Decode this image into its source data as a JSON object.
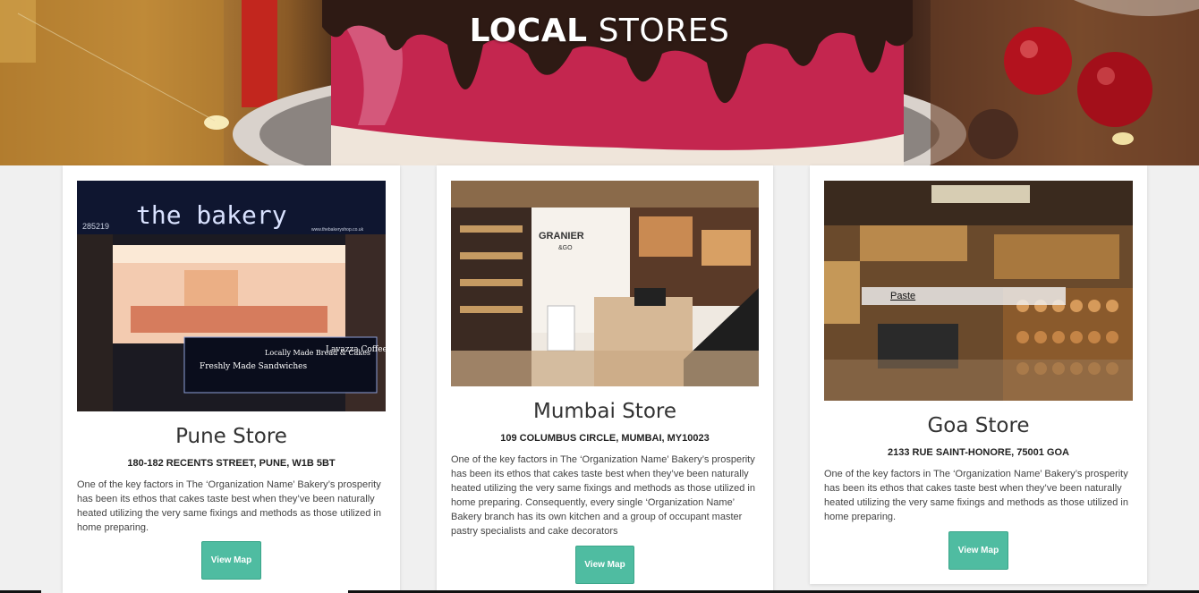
{
  "hero": {
    "title_bold": "LOCAL",
    "title_rest": " STORES"
  },
  "stores": [
    {
      "name": "Pune Store",
      "address": "180-182 RECENTS STREET, PUNE, W1B 5BT",
      "description": "One of the key factors in The ‘Organization Name’ Bakery’s prosperity has been its ethos that cakes taste best when they’ve been naturally heated utilizing the very same fixings and methods as those utilized in home preparing.",
      "button": "View Map",
      "photo": {
        "sign": "the bakery",
        "phone": "285219",
        "url": "www.thebakeryshop.co.uk",
        "panel1": "Freshly Made Sandwiches",
        "panel2": "Locally Made Bread & Cakes",
        "panel3": "Lavazza Coffee"
      }
    },
    {
      "name": "Mumbai Store",
      "address": "109 COLUMBUS CIRCLE, MUMBAI, MY10023",
      "description": "One of the key factors in The ‘Organization Name’ Bakery’s prosperity has been its ethos that cakes taste best when they’ve been naturally heated utilizing the very same fixings and methods as those utilized in home preparing. Consequently, every single ‘Organization Name’ Bakery branch has its own kitchen and a group of occupant master pastry specialists and cake decorators",
      "button": "View Map",
      "photo": {
        "brand": "GRANIER",
        "brand_sub": "&GO"
      }
    },
    {
      "name": "Goa Store",
      "address": "2133 RUE SAINT-HONORE, 75001 GOA",
      "description": "One of the key factors in The ‘Organization Name’ Bakery’s prosperity has been its ethos that cakes taste best when they’ve been naturally heated utilizing the very same fixings and methods as those utilized in home preparing.",
      "button": "View Map",
      "tooltip": "Paste"
    }
  ],
  "colors": {
    "accent": "#4fbca1",
    "background": "#f0f0f0",
    "card": "#ffffff"
  }
}
